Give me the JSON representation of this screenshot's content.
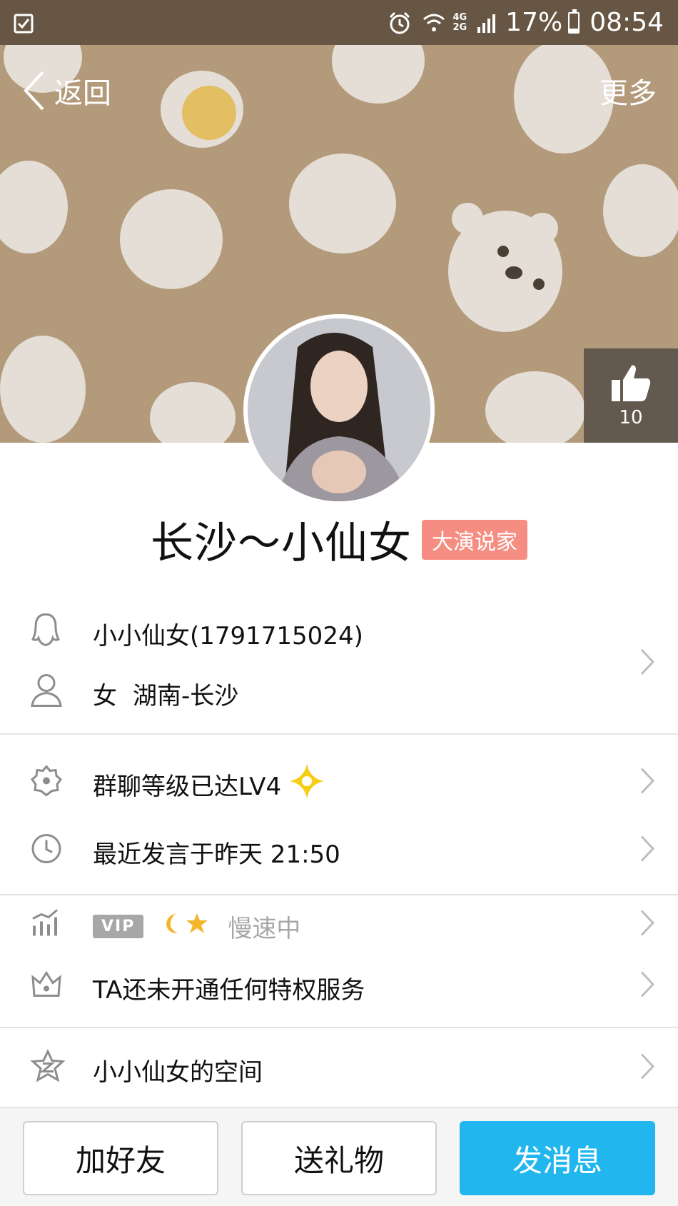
{
  "status_bar": {
    "battery": "17%",
    "time": "08:54",
    "network_top": "4G",
    "network_bottom": "2G"
  },
  "nav": {
    "back_label": "返回",
    "more_label": "更多"
  },
  "like": {
    "count": "10"
  },
  "profile": {
    "name": "长沙～小仙女",
    "badge": "大演说家"
  },
  "info": {
    "account": "小小仙女(1791715024)",
    "gender": "女",
    "location": "湖南-长沙"
  },
  "group": {
    "level": "群聊等级已达LV4",
    "last_speak": "最近发言于昨天 21:50"
  },
  "vip": {
    "tag": "VIP",
    "status": "慢速中",
    "privilege": "TA还未开通任何特权服务"
  },
  "space": {
    "label": "小小仙女的空间"
  },
  "actions": {
    "add_friend": "加好友",
    "send_gift": "送礼物",
    "send_message": "发消息"
  },
  "colors": {
    "cover_bg": "#b39a7b",
    "badge_bg": "#f58d82",
    "primary": "#21b7ee"
  }
}
